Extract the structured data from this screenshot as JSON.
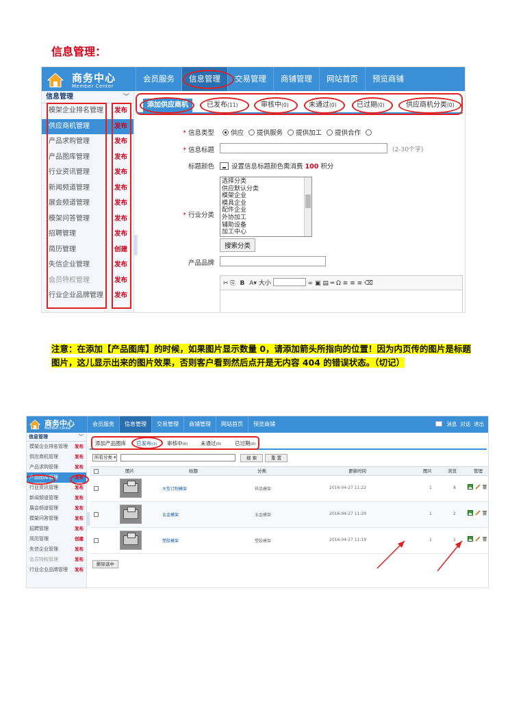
{
  "heading": "信息管理：",
  "shot1": {
    "logo": {
      "title": "商务中心",
      "subtitle": "Member Center"
    },
    "nav": [
      "会员服务",
      "信息管理",
      "交易管理",
      "商铺管理",
      "网站首页",
      "预览商铺"
    ],
    "sidebar_title": "信息管理",
    "sidebar": [
      {
        "label": "模架企业排名管理",
        "tag": "发布"
      },
      {
        "label": "供应商机管理",
        "tag": "发布"
      },
      {
        "label": "产品求购管理",
        "tag": "发布"
      },
      {
        "label": "产品图库管理",
        "tag": "发布"
      },
      {
        "label": "行业资讯管理",
        "tag": "发布"
      },
      {
        "label": "新闻频道管理",
        "tag": "发布"
      },
      {
        "label": "展会频道管理",
        "tag": "发布"
      },
      {
        "label": "模架问答管理",
        "tag": "发布"
      },
      {
        "label": "招聘管理",
        "tag": "发布"
      },
      {
        "label": "简历管理",
        "tag": "创建"
      },
      {
        "label": "失信企业管理",
        "tag": "发布"
      },
      {
        "label": "会员特权管理",
        "tag": "发布"
      },
      {
        "label": "行业企业品牌管理",
        "tag": "发布"
      }
    ],
    "tabs": [
      {
        "label": "添加供应商机",
        "count": ""
      },
      {
        "label": "已发布",
        "count": "(11)"
      },
      {
        "label": "审核中",
        "count": "(0)"
      },
      {
        "label": "未通过",
        "count": "(0)"
      },
      {
        "label": "已过期",
        "count": "(0)"
      },
      {
        "label": "供应商机分类",
        "count": "(0)"
      }
    ],
    "form": {
      "type_label": "信息类型",
      "type_options": [
        "供应",
        "提供服务",
        "提供加工",
        "提供合作"
      ],
      "title_label": "信息标题",
      "title_hint": "(2-30个字)",
      "color_label": "标题颜色",
      "color_text": "设置信息标题颜色需消费",
      "color_points": "100",
      "color_unit": "积分",
      "category_label": "行业分类",
      "category_options": [
        "选择分类",
        "供应默认分类",
        "模架企业",
        "模具企业",
        "配件企业",
        "外协加工",
        "辅助设备",
        "加工中心"
      ],
      "category_button": "搜索分类",
      "brand_label": "产品品牌",
      "toolbar_size": "大小"
    }
  },
  "note": "注意：在添加【产品图库】的时候，如果图片显示数量 0，请添加箭头所指向的位置！因为内页传的图片是标题图片，这儿显示出来的图片效果，否则客户看到然后点开是无内容 404 的错误状态。（切记）",
  "shot2": {
    "logo": {
      "title": "商务中心",
      "subtitle": "Member Center"
    },
    "nav": [
      "会员服务",
      "信息管理",
      "交易管理",
      "商铺管理",
      "网站首页",
      "预览商铺"
    ],
    "header_right": {
      "msg": "消息",
      "chat": "对话",
      "logout": "退出"
    },
    "sidebar_title": "信息管理",
    "sidebar": [
      {
        "label": "模架企业排名管理",
        "tag": "发布"
      },
      {
        "label": "供应商机管理",
        "tag": "发布"
      },
      {
        "label": "产品求购管理",
        "tag": "发布"
      },
      {
        "label": "产品图库管理",
        "tag": "发布"
      },
      {
        "label": "行业资讯管理",
        "tag": "发布"
      },
      {
        "label": "新闻频道管理",
        "tag": "发布"
      },
      {
        "label": "展会频道管理",
        "tag": "发布"
      },
      {
        "label": "模架问答管理",
        "tag": "发布"
      },
      {
        "label": "招聘管理",
        "tag": "发布"
      },
      {
        "label": "简历管理",
        "tag": "创建"
      },
      {
        "label": "失信企业管理",
        "tag": "发布"
      },
      {
        "label": "会员特权管理",
        "tag": "发布"
      },
      {
        "label": "行业企业品牌管理",
        "tag": "发布"
      }
    ],
    "tabs": [
      {
        "label": "添加产品图库",
        "count": ""
      },
      {
        "label": "已发布",
        "count": "(3)"
      },
      {
        "label": "审核中",
        "count": "(0)"
      },
      {
        "label": "未通过",
        "count": "(0)"
      },
      {
        "label": "已过期",
        "count": "(0)"
      }
    ],
    "filter": {
      "select": "所有分类",
      "search_btn": "搜 索",
      "reset_btn": "重 置"
    },
    "columns": [
      "图片",
      "标题",
      "分类",
      "更新时间",
      "图片",
      "浏览",
      "管理"
    ],
    "rows": [
      {
        "title": "大型订制模架",
        "category": "样品模架",
        "time": "2016-04-27 11:22",
        "pics": "1",
        "views": "8"
      },
      {
        "title": "五金模架",
        "category": "五金模架",
        "time": "2016-04-27 11:20",
        "pics": "1",
        "views": "2"
      },
      {
        "title": "塑胶模架",
        "category": "塑胶模架",
        "time": "2016-04-27 11:19",
        "pics": "1",
        "views": "1"
      }
    ],
    "delete_btn": "删除选中"
  }
}
